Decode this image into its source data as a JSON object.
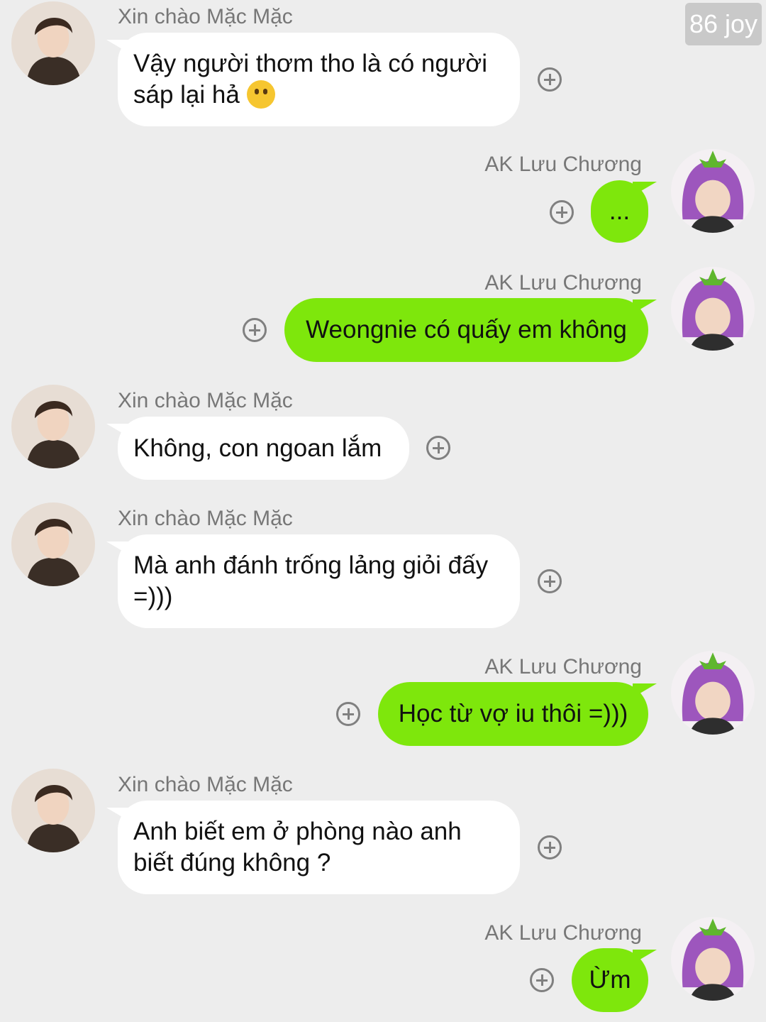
{
  "watermark": "86 joy",
  "senders": {
    "other": "Xin chào Mặc Mặc",
    "me": "AK Lưu Chương"
  },
  "messages": [
    {
      "side": "left",
      "name": "Xin chào Mặc Mặc",
      "lines": [
        "Vậy người thơm tho là có người",
        "sáp lại hả"
      ],
      "emoji": "thinking-face-emoji"
    },
    {
      "side": "right",
      "name": "AK Lưu Chương",
      "lines": [
        "..."
      ]
    },
    {
      "side": "right",
      "name": "AK Lưu Chương",
      "lines": [
        "Weongnie có quấy em không"
      ]
    },
    {
      "side": "left",
      "name": "Xin chào Mặc Mặc",
      "lines": [
        "Không, con ngoan lắm"
      ]
    },
    {
      "side": "left",
      "name": "Xin chào Mặc Mặc",
      "lines": [
        "Mà anh đánh trống lảng giỏi đấy",
        "=)))"
      ]
    },
    {
      "side": "right",
      "name": "AK Lưu Chương",
      "lines": [
        "Học từ vợ iu thôi =)))"
      ]
    },
    {
      "side": "left",
      "name": "Xin chào Mặc Mặc",
      "lines": [
        "Anh biết em ở phòng nào anh",
        "biết đúng không ?"
      ]
    },
    {
      "side": "right",
      "name": "AK Lưu Chương",
      "lines": [
        "Ừm"
      ]
    }
  ],
  "icons": {
    "add": "plus-circle-icon",
    "other_avatar": "profile-photo-avatar",
    "my_avatar": "eggplant-hat-avatar"
  },
  "colors": {
    "background": "#ededed",
    "incoming_bubble": "#ffffff",
    "outgoing_bubble": "#7ee70c",
    "name_text": "#777777"
  }
}
